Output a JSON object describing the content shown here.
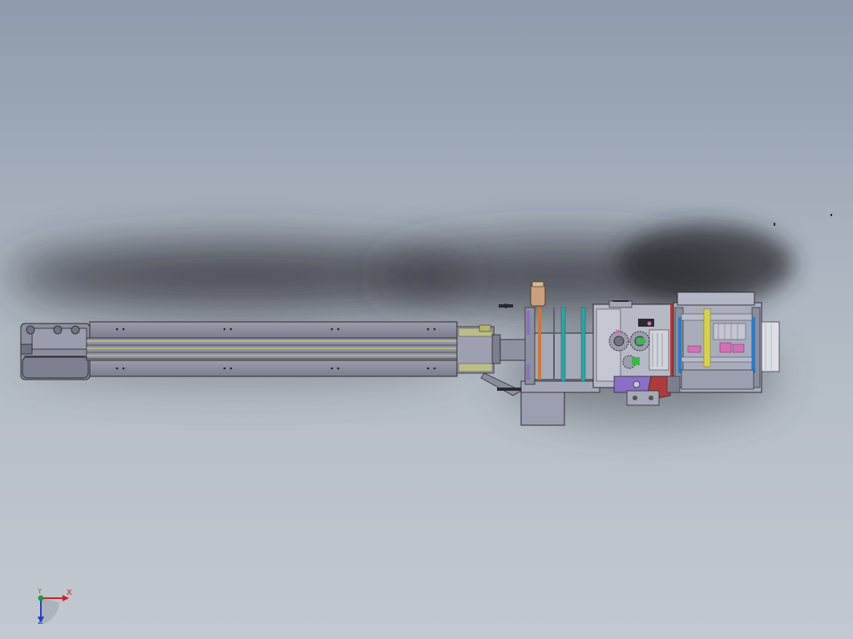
{
  "viewport": {
    "model": "conveyor-machine-assembly",
    "view": "top",
    "display_mode": "shaded-with-edges",
    "shadows": true,
    "background": {
      "top": "#8e9bac",
      "bottom": "#c2c8d0"
    }
  },
  "triad": {
    "x_label": "X",
    "y_label": "Y",
    "z_label": "Z",
    "colors": {
      "x": "#d21e1e",
      "y": "#1f9a3a",
      "z": "#2040c8"
    }
  },
  "colors": {
    "frame": "#8a8d9e",
    "frame_dark": "#6f7283",
    "rail_accent": "#c9cc76",
    "teal": "#2aa6a6",
    "purple": "#8a6fc8",
    "red": "#b23a3a",
    "yellow": "#d8d24a",
    "pink": "#d66fb8",
    "brass": "#c9a07a"
  }
}
